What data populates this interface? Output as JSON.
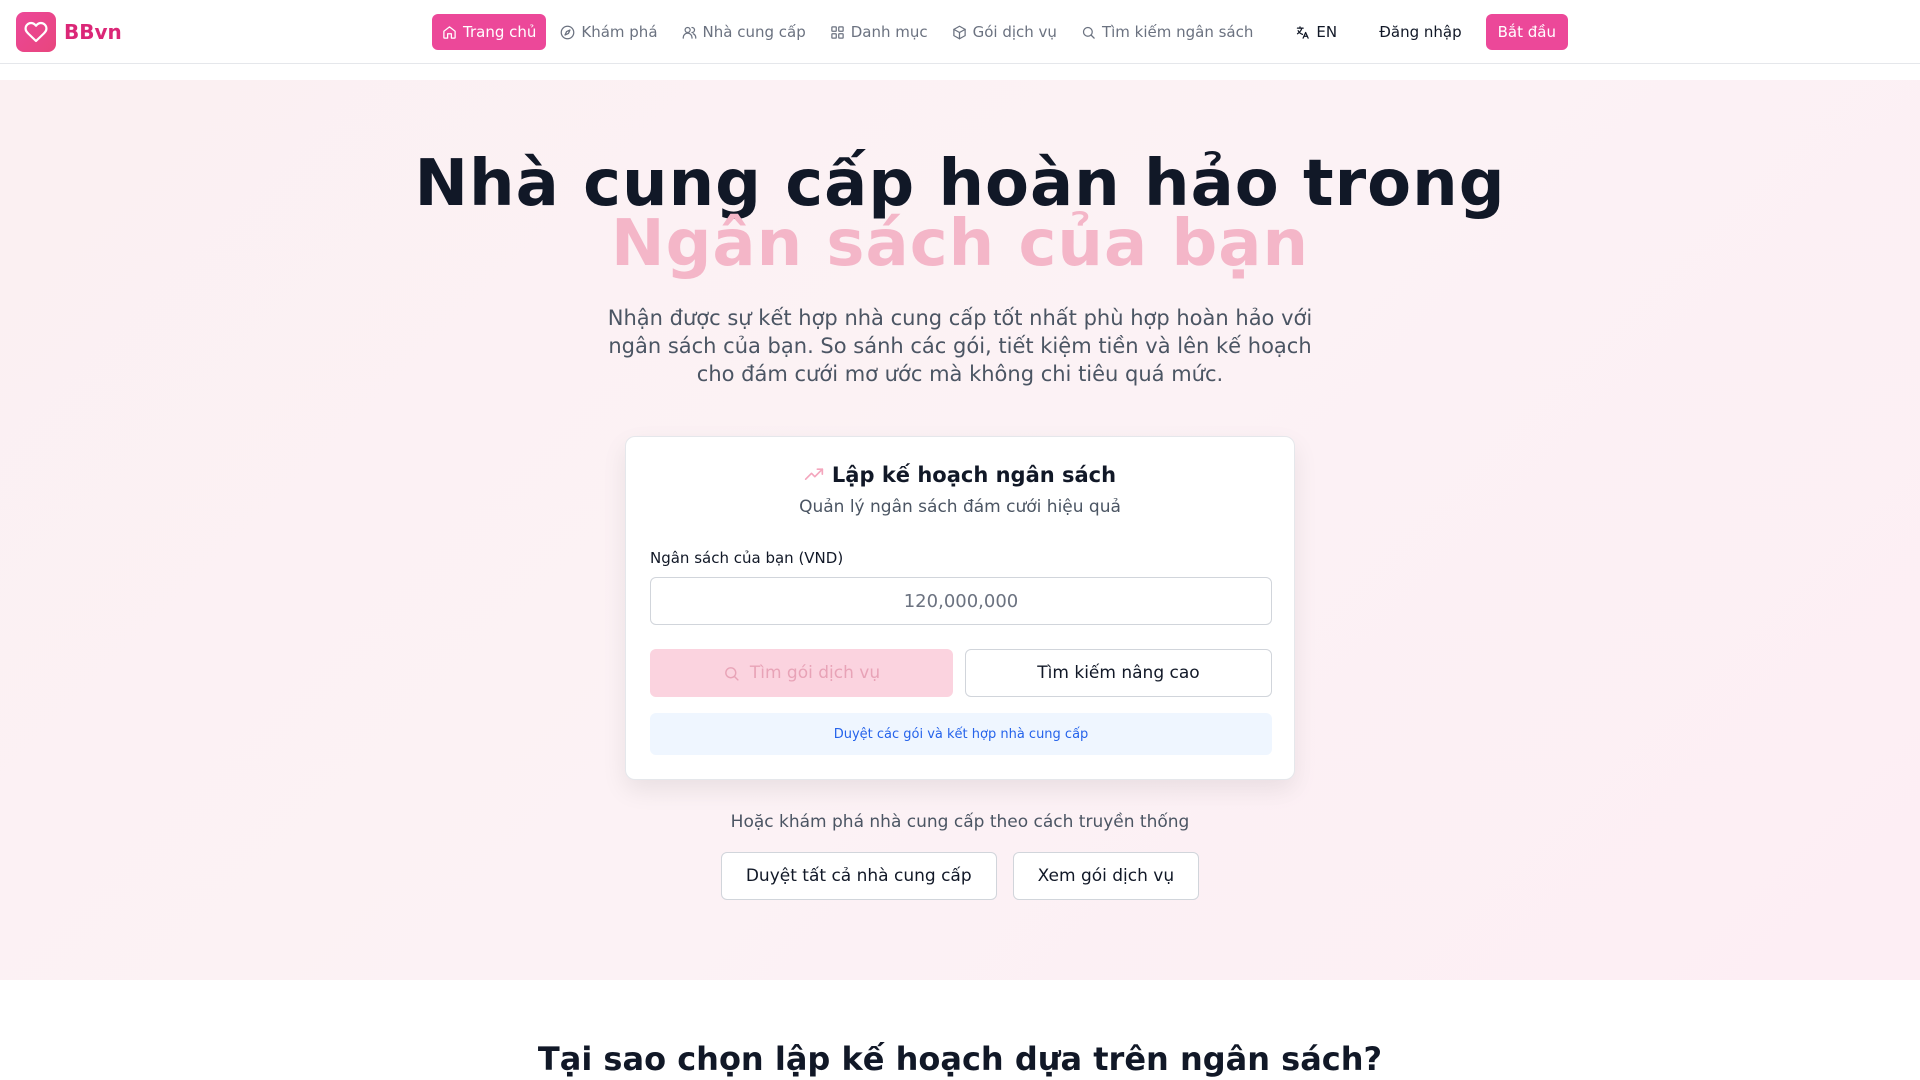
{
  "brand": {
    "name": "BBvn",
    "logo_icon": "heart-icon"
  },
  "nav": {
    "items": [
      {
        "label": "Trang chủ",
        "icon": "home-icon",
        "active": true
      },
      {
        "label": "Khám phá",
        "icon": "compass-icon",
        "active": false
      },
      {
        "label": "Nhà cung cấp",
        "icon": "users-icon",
        "active": false
      },
      {
        "label": "Danh mục",
        "icon": "grid-icon",
        "active": false
      },
      {
        "label": "Gói dịch vụ",
        "icon": "package-icon",
        "active": false
      },
      {
        "label": "Tìm kiếm ngân sách",
        "icon": "search-icon",
        "active": false
      }
    ],
    "language": "EN",
    "language_icon": "translate-icon",
    "login": "Đăng nhập",
    "start": "Bắt đầu"
  },
  "hero": {
    "title_line1": "Nhà cung cấp hoàn hảo trong",
    "title_line2": "Ngân sách của bạn",
    "subtitle": "Nhận được sự kết hợp nhà cung cấp tốt nhất phù hợp hoàn hảo với ngân sách của bạn. So sánh các gói, tiết kiệm tiền và lên kế hoạch cho đám cưới mơ ước mà không chi tiêu quá mức."
  },
  "planner": {
    "title": "Lập kế hoạch ngân sách",
    "title_icon": "trending-up-icon",
    "subtitle": "Quản lý ngân sách đám cưới hiệu quả",
    "budget_label": "Ngân sách của bạn (VND)",
    "budget_placeholder": "120,000,000",
    "budget_value": "",
    "find_button": "Tìm gói dịch vụ",
    "advanced_button": "Tìm kiếm nâng cao",
    "info": "Duyệt các gói và kết hợp nhà cung cấp"
  },
  "alternative": {
    "text": "Hoặc khám phá nhà cung cấp theo cách truyền thống",
    "browse_vendors": "Duyệt tất cả nhà cung cấp",
    "view_packages": "Xem gói dịch vụ"
  },
  "section": {
    "title": "Tại sao chọn lập kế hoạch dựa trên ngân sách?"
  },
  "colors": {
    "accent": "#ec4899",
    "accent_light": "#f4b6c8",
    "info_bg": "#eff6ff",
    "info_text": "#2563eb"
  }
}
